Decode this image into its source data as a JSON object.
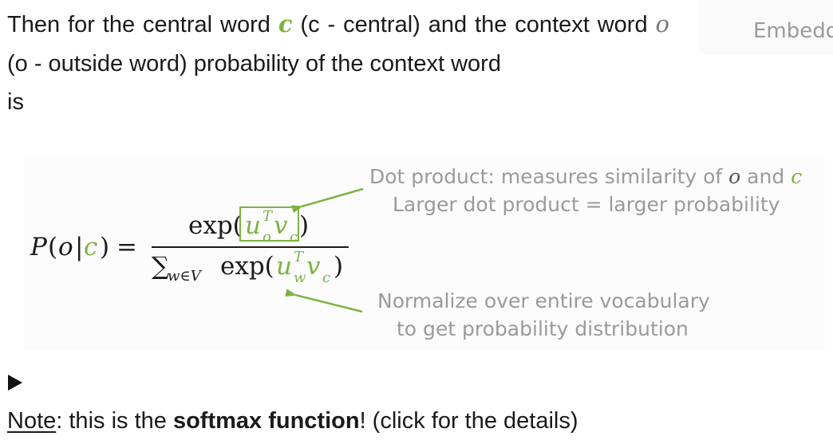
{
  "intro": {
    "part1": "Then for the central word ",
    "var_c": "c",
    "part2": " (c - central) and the context word ",
    "var_o": "o",
    "part3": " (o - outside word) probability of the context word",
    "part4": "is"
  },
  "side_tab": {
    "label": "Embedd"
  },
  "formula": {
    "lhs_p": "P",
    "lhs_open": "(",
    "lhs_o": "o",
    "lhs_bar": "|",
    "lhs_c": "c",
    "lhs_close": ")",
    "equals": "=",
    "num_exp": "exp(",
    "num_u": "u",
    "num_u_sup": "T",
    "num_u_sub": "o",
    "num_v": "v",
    "num_v_sub": "c",
    "num_close": ")",
    "den_sum": "∑",
    "den_sum_sub": "w∈V",
    "den_exp": "exp(",
    "den_u": "u",
    "den_u_sup": "T",
    "den_u_sub": "w",
    "den_v": "v",
    "den_v_sub": "c",
    "den_close": ")"
  },
  "annotations": {
    "top_line1_text": "Dot product: measures similarity of ",
    "top_line1_o": "o",
    "top_line1_and": " and ",
    "top_line1_c": "c",
    "top_line2": "Larger dot product = larger probability",
    "bottom_line1": "Normalize over entire vocabulary",
    "bottom_line2": "to get probability distribution"
  },
  "note": {
    "label": "Note",
    "text1": ": this is the ",
    "bold": "softmax function",
    "text2": "! (click for the details)"
  },
  "colors": {
    "accent_green": "#7cb342",
    "annotation_gray": "#9a9a9a",
    "text": "#1a1a1a"
  }
}
